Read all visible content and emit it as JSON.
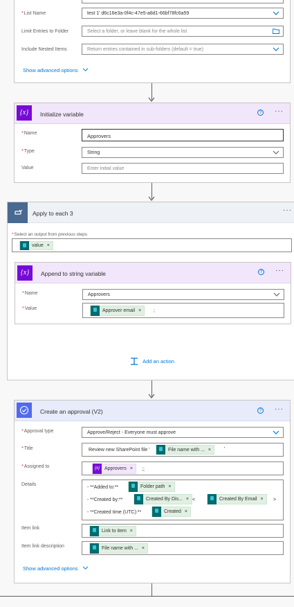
{
  "get_items": {
    "list_name_label": "List Name",
    "list_name_value": "test 1' d6c16e3a-0f4c-47e5-a8d1-66bf78fc6a59",
    "limit_label": "Limit Entries to Folder",
    "limit_placeholder": "Select a folder, or leave blank for the whole list",
    "nested_label": "Include Nested Items",
    "nested_value": "Return entries contained in sub-folders (default = true)",
    "advanced_link": "Show advanced options"
  },
  "init_var": {
    "title": "Initialize variable",
    "icon_text": "{x}",
    "name_label": "Name",
    "name_value": "Approvers",
    "type_label": "Type",
    "type_value": "String",
    "value_label": "Value",
    "value_placeholder": "Enter initial value"
  },
  "apply": {
    "title": "Apply to each 3",
    "select_label": "Select an output from previous steps",
    "token": "value",
    "add_action": "Add an action"
  },
  "append": {
    "title": "Append to string variable",
    "icon_text": "{x}",
    "name_label": "Name",
    "name_value": "Approvers",
    "value_label": "Value",
    "value_token": "Approver email",
    "value_suffix": ";"
  },
  "approval": {
    "title": "Create an approval (V2)",
    "type_label": "Approval type",
    "type_value": "Approve/Reject - Everyone must approve",
    "title_label": "Title",
    "title_prefix": "Review new SharePoint file '",
    "title_token": "File name with ...",
    "title_suffix": "'",
    "assigned_label": "Assigned to",
    "assigned_token": "Approvers",
    "assigned_suffix": ";;",
    "details_label": "Details",
    "d1_prefix": "- **Added to:**",
    "d1_token": "Folder path",
    "d2_prefix": "- **Created by:**",
    "d2_token1": "Created By Dis...",
    "d2_mid": "<",
    "d2_token2": "Created By Email",
    "d2_suffix": ">",
    "d3_prefix": "- **Created time (UTC):**",
    "d3_token": "Created",
    "itemlink_label": "Item link",
    "itemlink_token": "Link to item",
    "itemdesc_label": "Item link description",
    "itemdesc_token": "File name with ...",
    "advanced_link": "Show advanced options"
  },
  "common": {
    "required": "*",
    "remove": "×",
    "more": "···",
    "help": "?"
  },
  "colors": {
    "variable": "#770bd6",
    "apply_header": "#eef1f5",
    "approval": "#4f6bed",
    "link": "#0078d4"
  }
}
